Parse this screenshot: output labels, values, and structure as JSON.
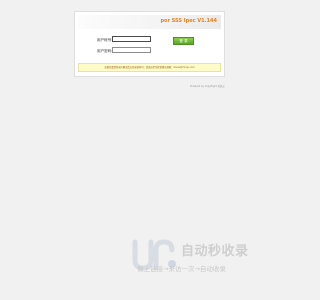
{
  "login": {
    "brand": "por SSS Ipec V1.144",
    "field1_label": "用户帐号:",
    "field2_label": "用户密码:",
    "field1_value": "",
    "field2_value": "",
    "submit_label": "登 录",
    "notice": "如果您遇到登录问题或遗忘登录密码时，请发送至系统管理员邮箱：ilovse@mnqu.com",
    "powered": "Powered by CopyEight 系统之"
  },
  "watermark": {
    "title": "自动秒收录",
    "subtitle": "做上链接→来访一次→自动收录"
  },
  "colors": {
    "brand": "#e4821d",
    "button": "#59a626",
    "notice_bg": "#fdfcc8",
    "watermark": "#cfcfcf"
  }
}
